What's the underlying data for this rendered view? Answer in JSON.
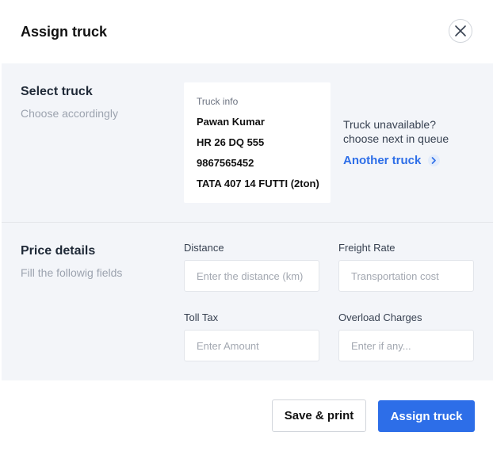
{
  "dialog": {
    "title": "Assign truck",
    "close_icon": "close-icon"
  },
  "select_truck": {
    "title": "Select truck",
    "subtitle": "Choose accordingly",
    "card": {
      "label": "Truck info",
      "driver": "Pawan Kumar",
      "number": "HR 26 DQ 555",
      "phone": "9867565452",
      "model": "TATA 407 14 FUTTI (2ton)"
    },
    "unavailable_line1": "Truck unavailable?",
    "unavailable_line2": "choose next in queue",
    "another_label": "Another truck",
    "another_icon": "chevron-right-icon"
  },
  "price_details": {
    "title": "Price details",
    "subtitle": "Fill the followig fields",
    "fields": {
      "distance": {
        "label": "Distance",
        "placeholder": "Enter the distance (km)"
      },
      "freight": {
        "label": "Freight Rate",
        "placeholder": "Transportation cost"
      },
      "toll": {
        "label": "Toll Tax",
        "placeholder": "Enter Amount"
      },
      "overload": {
        "label": "Overload Charges",
        "placeholder": "Enter if any..."
      }
    }
  },
  "footer": {
    "save_label": "Save & print",
    "assign_label": "Assign truck"
  },
  "colors": {
    "accent": "#2d6ee8",
    "panel_bg": "#f3f5f9"
  }
}
